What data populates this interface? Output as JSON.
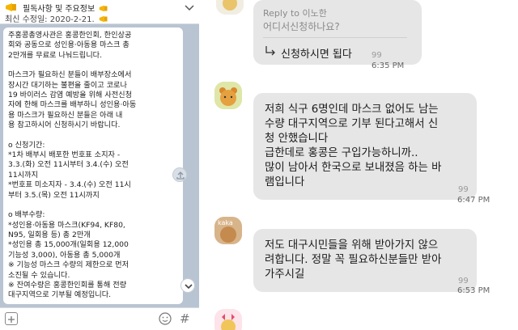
{
  "left_panel": {
    "notice": {
      "title": "필독사항 및 주요정보",
      "subtitle": "최신 수정일: 2020-2-21."
    },
    "announcement_lines": [
      "주홍콩총영사관은 홍콩한인회, 한인상공",
      "회와 공동으로 성인용·아동용 마스크 총",
      "2만개를 무료로 나눠드립니다.",
      "",
      "마스크가 필요하신 분들이 배부장소에서",
      "장시간 대기하는 불편을 줄이고 코로나",
      "19 바이러스 감염 예방을 위해 사전신청",
      "자에 한해 마스크를 배부하니 성인용·아동",
      "용 마스크가 필요하신 분들은 아래 내",
      "용 참고하시어 신청하시기 바랍니다.",
      "",
      "o 신청기간:",
      "*1차 배부시 배포한 번호표 소지자 -",
      "3.3.(화) 오전 11시부터 3.4.(수) 오전",
      "11시까지",
      "*번호표 미소지자 - 3.4.(수) 오전 11시",
      "부터 3.5.(목) 오전 11시까지",
      "",
      "o 배부수량:",
      "*성인용·아동용 마스크(KF94, KF80,",
      "N95, 일회용 등) 총 2만개",
      "*성인용 총 15,000개(일회용 12,000",
      "기능성 3,000), 아동용 총 5,000개",
      "※ 기능성 마스크 수량의 제한으로 먼저",
      "소진될 수 있습니다.",
      "※ 잔여수량은 홍콩한인회를 통해 전량",
      "대구지역으로 기부될 예정입니다."
    ],
    "input_hash_symbol": "#"
  },
  "right_panel": {
    "reply": {
      "reply_to": "Reply to 이노한",
      "quoted": "어디서신청하나요?",
      "text": "신청하시면 됩다",
      "unread": "99",
      "time": "6:35 PM"
    },
    "messages": [
      {
        "lines": [
          "저희 식구 6명인데 마스크 없어도 남는",
          "수량 대구지역으로 기부 된다고해서 신",
          "청 안했습니다",
          "급한데로 홍콩은 구입가능하니까..",
          "많이 남아서 한국으로 보내졌음 하는 바",
          "램입니다"
        ],
        "unread": "99",
        "time": "6:47 PM"
      },
      {
        "avatar_label": "kaka",
        "lines": [
          "저도 대구시민들을 위해 받아가지 않으",
          "려합니다. 정말 꼭 필요하신분들만 받아",
          "가주시길"
        ],
        "unread": "99",
        "time": "6:53 PM"
      }
    ]
  },
  "colors": {
    "left_background": "#b9c4d2",
    "bubble_background": "#e6e6e6",
    "notice_icon": "#f5b400"
  }
}
